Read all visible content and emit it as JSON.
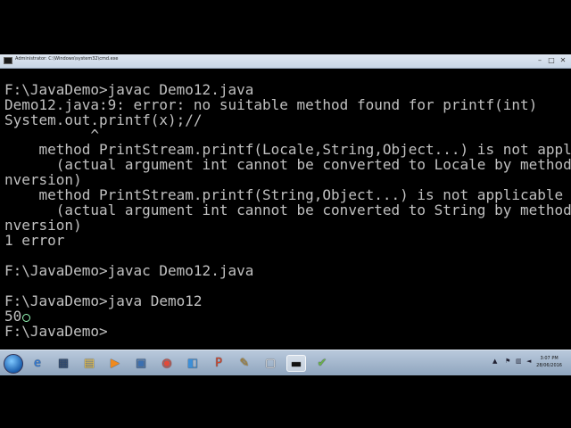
{
  "window": {
    "title": "Administrator: C:\\Windows\\system32\\cmd.exe",
    "controls": {
      "minimize": "–",
      "maximize": "□",
      "close": "✕"
    }
  },
  "console": {
    "lines": [
      "F:\\JavaDemo>javac Demo12.java",
      "Demo12.java:9: error: no suitable method found for printf(int)",
      "System.out.printf(x);//",
      "          ^",
      "    method PrintStream.printf(Locale,String,Object...) is not applicable",
      "      (actual argument int cannot be converted to Locale by method invocation co",
      "nversion)",
      "    method PrintStream.printf(String,Object...) is not applicable",
      "      (actual argument int cannot be converted to String by method invocation co",
      "nversion)",
      "1 error",
      "",
      "F:\\JavaDemo>javac Demo12.java",
      "",
      "F:\\JavaDemo>java Demo12",
      "50",
      "F:\\JavaDemo>"
    ]
  },
  "taskbar": {
    "buttons": [
      {
        "icon": "ie-icon",
        "glyph": "e",
        "color": "#2a7be0"
      },
      {
        "icon": "media-center-icon",
        "glyph": "▦",
        "color": "#2c4a74"
      },
      {
        "icon": "explorer-icon",
        "glyph": "▤",
        "color": "#f0c850"
      },
      {
        "icon": "media-player-icon",
        "glyph": "▶",
        "color": "#f08a1e"
      },
      {
        "icon": "network-icon",
        "glyph": "▣",
        "color": "#3b6fb0"
      },
      {
        "icon": "chrome-icon",
        "glyph": "◉",
        "color": "#e04a3a"
      },
      {
        "icon": "remote-desktop-icon",
        "glyph": "◧",
        "color": "#3d8fd8"
      },
      {
        "icon": "powerpoint-icon",
        "glyph": "P",
        "color": "#d2452b"
      },
      {
        "icon": "paint-icon",
        "glyph": "✎",
        "color": "#c89a3a"
      },
      {
        "icon": "virtualbox-icon",
        "glyph": "▢",
        "color": "#e8e8e8"
      },
      {
        "icon": "cmd-icon",
        "glyph": "▬",
        "color": "#111111"
      },
      {
        "icon": "notepad-icon",
        "glyph": "✔",
        "color": "#6bb34a"
      }
    ],
    "clock": {
      "time": "3:07 PM",
      "date": "28/06/2016"
    }
  }
}
